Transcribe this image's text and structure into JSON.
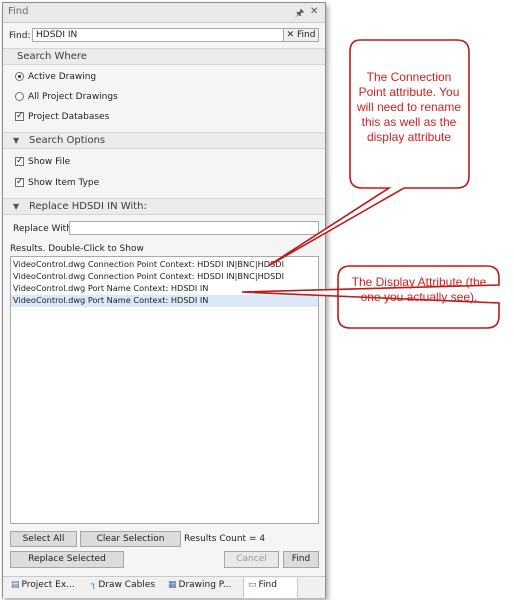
{
  "window": {
    "title": "Find",
    "pin_icon": "pin-icon",
    "close_icon": "close-icon"
  },
  "find": {
    "label": "Find:",
    "value": "HDSDI IN",
    "clear_icon": "clear-x-icon",
    "button_label": "Find"
  },
  "search_where": {
    "header": "Search Where",
    "options": [
      {
        "label": "Active Drawing",
        "selected": true
      },
      {
        "label": "All Project Drawings",
        "selected": false
      }
    ],
    "project_databases": {
      "label": "Project Databases",
      "checked": true
    }
  },
  "search_options": {
    "header": "Search Options",
    "show_file": {
      "label": "Show File",
      "checked": true
    },
    "show_item_type": {
      "label": "Show Item Type",
      "checked": true
    }
  },
  "replace": {
    "header": "Replace HDSDI IN With:",
    "label": "Replace With",
    "value": ""
  },
  "results": {
    "label": "Results. Double-Click to Show",
    "rows": [
      "VideoControl.dwg Connection Point Context: HDSDI IN|BNC|HDSDI",
      "VideoControl.dwg Connection Point Context: HDSDI IN|BNC|HDSDI",
      "VideoControl.dwg Port Name Context: HDSDI IN",
      "VideoControl.dwg Port Name Context: HDSDI IN"
    ],
    "selected_index": 3
  },
  "actions": {
    "select_all": "Select All",
    "clear_selection": "Clear Selection",
    "results_count": "Results Count = 4",
    "replace_selected": "Replace Selected",
    "cancel": "Cancel",
    "find": "Find"
  },
  "tabs": [
    {
      "label": "Project Ex...",
      "icon": "project-explorer-icon"
    },
    {
      "label": "Draw Cables",
      "icon": "draw-cables-icon"
    },
    {
      "label": "Drawing P...",
      "icon": "drawing-properties-icon"
    },
    {
      "label": "Find",
      "icon": "find-tab-icon"
    }
  ],
  "callouts": {
    "connection_point": "The Connection Point attribute. You will need to rename this as well as the display attribute",
    "display": "The Display Attribute (the one you actually see)."
  },
  "colors": {
    "callout_border": "#c01818",
    "callout_text": "#d22020",
    "selection": "#dbe8f8"
  }
}
